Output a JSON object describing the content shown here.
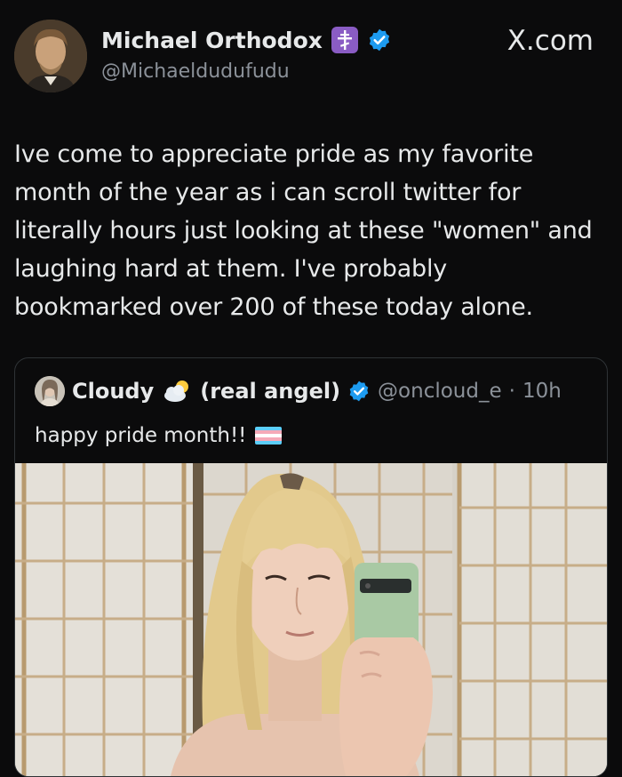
{
  "post": {
    "display_name": "Michael Orthodox",
    "handle": "@Michaeldudufudu",
    "site": "X.com",
    "text": "Ive come to appreciate pride as my favorite month of the year as i can scroll twitter for literally hours just looking at these \"women\" and laughing hard at them. I've probably bookmarked over 200 of these today alone."
  },
  "quoted": {
    "display_name": "Cloudy",
    "name_suffix": "(real angel)",
    "handle": "@oncloud_e",
    "separator": "·",
    "time": "10h",
    "text": "happy pride month!!"
  },
  "icons": {
    "cross": "orthodox-cross-icon",
    "verified": "verified-badge-icon",
    "cloud": "sun-behind-cloud-icon",
    "flag": "transgender-flag-icon"
  },
  "colors": {
    "background": "#0b0b0c",
    "verified": "#1d9bf0",
    "cross_badge": "#8a5cc4",
    "muted_text": "#8b9199",
    "flag_blue": "#5bcefa",
    "flag_pink": "#f5a9b8",
    "flag_white": "#ffffff"
  }
}
